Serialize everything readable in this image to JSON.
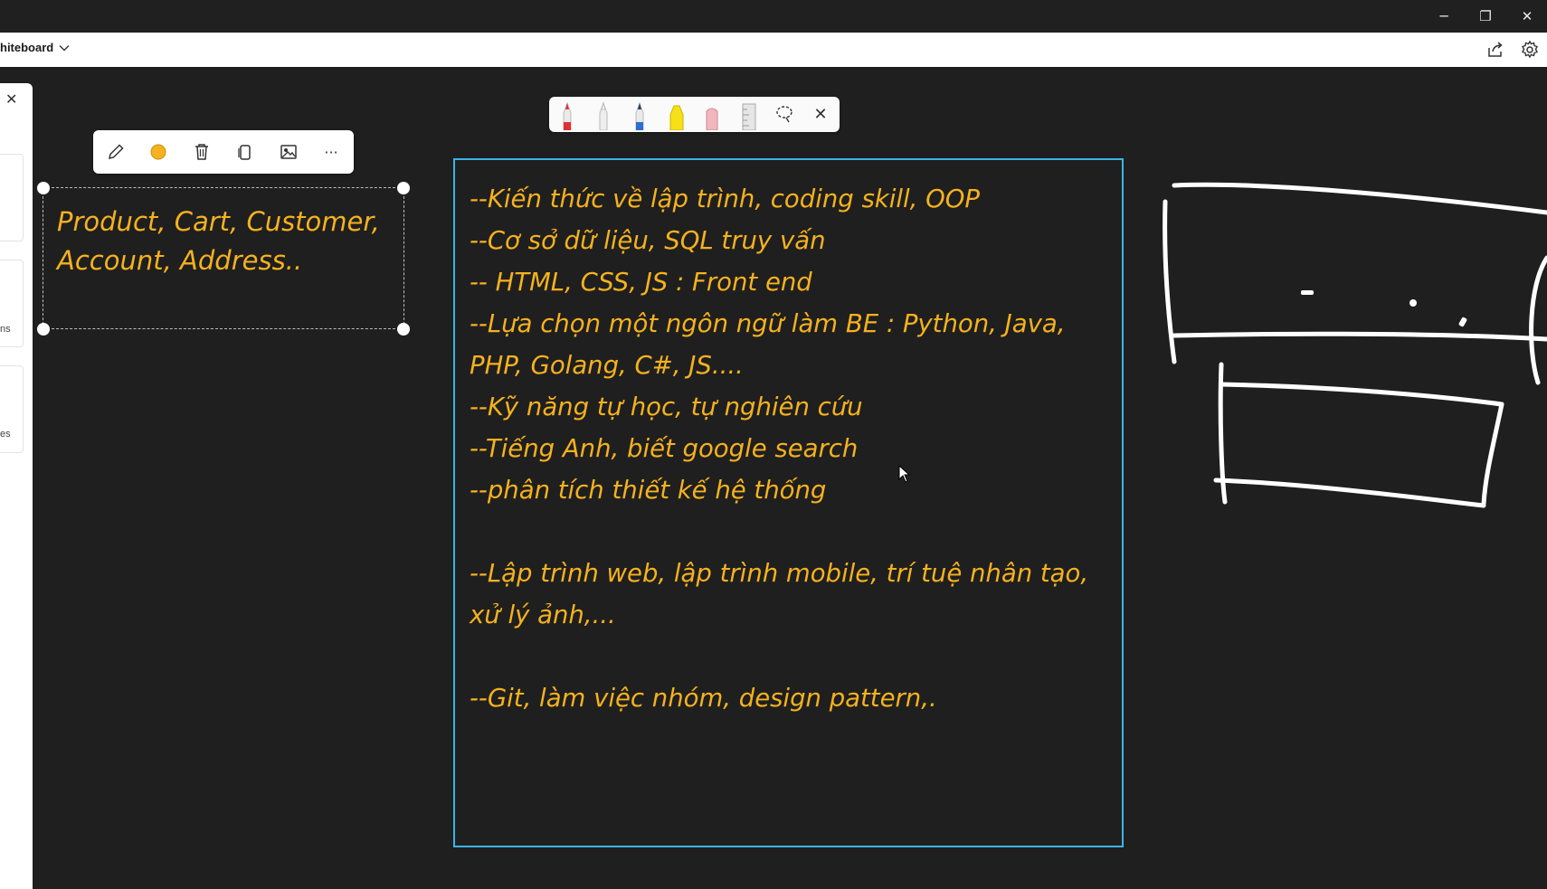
{
  "app": {
    "title": "hiteboard"
  },
  "window_controls": {
    "minimize": "─",
    "restore": "❐",
    "close": "✕"
  },
  "sidebar": {
    "close_label": "✕",
    "snippets": [
      "ns",
      "es"
    ]
  },
  "colors": {
    "ink": "#f5b21e",
    "selection": "#3bb4e6",
    "canvas": "#1f1f1f"
  },
  "pen_toolbar": {
    "tools": [
      "red-pen",
      "white-pen",
      "blue-pen",
      "yellow-highlighter",
      "eraser",
      "ruler",
      "lasso-select"
    ],
    "close_label": "✕"
  },
  "context_toolbar": {
    "tools": [
      "edit",
      "color",
      "delete",
      "copy",
      "image"
    ],
    "more_label": "···"
  },
  "small_note": {
    "lines": [
      "Product, Cart, Customer,",
      "Account, Address.."
    ]
  },
  "main_note": {
    "lines": [
      "--Kiến thức về lập trình, coding skill, OOP",
      "--Cơ sở dữ liệu, SQL truy vấn",
      "-- HTML, CSS, JS : Front end",
      "--Lựa chọn một ngôn ngữ làm BE : Python, Java, PHP, Golang, C#, JS....",
      "--Kỹ năng tự học, tự nghiên cứu",
      "--Tiếng Anh, biết google search",
      "--phân tích thiết kế hệ thống",
      "--Lập trình web, lập trình mobile, trí tuệ nhân tạo, xử lý ảnh,...",
      "--Git, làm việc nhóm, design pattern,."
    ]
  }
}
